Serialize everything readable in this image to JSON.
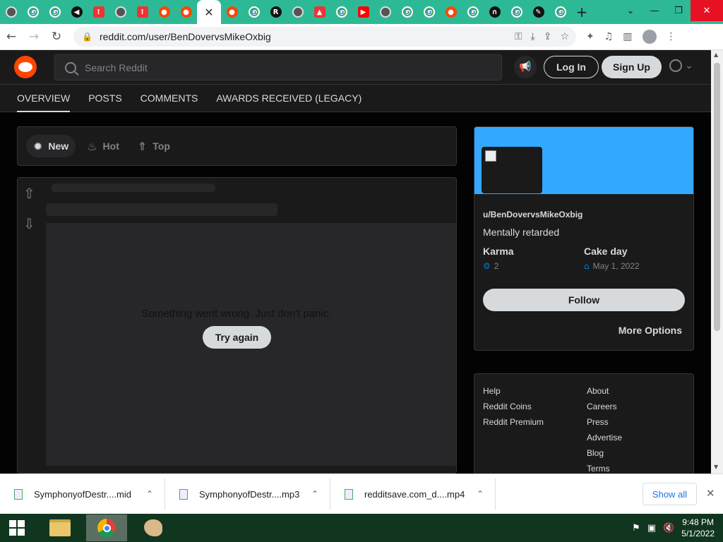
{
  "browser": {
    "tabs": [
      {
        "icon": "globe-icon",
        "cls": "w",
        "glyph": ""
      },
      {
        "icon": "google-icon",
        "cls": "g",
        "glyph": "G"
      },
      {
        "icon": "google-icon",
        "cls": "g",
        "glyph": "G"
      },
      {
        "icon": "audio-icon",
        "cls": "dk",
        "glyph": "◀"
      },
      {
        "icon": "mail-icon",
        "cls": "m",
        "glyph": "!"
      },
      {
        "icon": "chrome-icon",
        "cls": "w",
        "glyph": ""
      },
      {
        "icon": "mail-icon",
        "cls": "m",
        "glyph": "!"
      },
      {
        "icon": "reddit-icon",
        "cls": "r",
        "glyph": "●"
      },
      {
        "icon": "reddit-icon",
        "cls": "r",
        "glyph": "●"
      },
      {
        "icon": "close-icon",
        "cls": "active",
        "glyph": "✕"
      },
      {
        "icon": "reddit-icon",
        "cls": "r",
        "glyph": "●"
      },
      {
        "icon": "google-icon",
        "cls": "g",
        "glyph": "G"
      },
      {
        "icon": "r-icon",
        "cls": "dk",
        "glyph": "R"
      },
      {
        "icon": "globe-icon",
        "cls": "w",
        "glyph": ""
      },
      {
        "icon": "alert-icon",
        "cls": "m",
        "glyph": "▲"
      },
      {
        "icon": "google-icon",
        "cls": "g",
        "glyph": "G"
      },
      {
        "icon": "youtube-icon",
        "cls": "y",
        "glyph": "▶"
      },
      {
        "icon": "chrome-icon",
        "cls": "w",
        "glyph": ""
      },
      {
        "icon": "google-icon",
        "cls": "g",
        "glyph": "G"
      },
      {
        "icon": "google-icon",
        "cls": "g",
        "glyph": "G"
      },
      {
        "icon": "reddit-icon",
        "cls": "r",
        "glyph": "●"
      },
      {
        "icon": "google-icon",
        "cls": "g",
        "glyph": "G"
      },
      {
        "icon": "headphones-icon",
        "cls": "dk",
        "glyph": "∩"
      },
      {
        "icon": "google-icon",
        "cls": "g",
        "glyph": "G"
      },
      {
        "icon": "puzzle-icon",
        "cls": "dk",
        "glyph": "✎"
      },
      {
        "icon": "google-icon",
        "cls": "g",
        "glyph": "G"
      }
    ],
    "url": "reddit.com/user/BenDovervsMikeOxbig"
  },
  "header": {
    "search_placeholder": "Search Reddit",
    "login_label": "Log In",
    "signup_label": "Sign Up"
  },
  "profile_nav": [
    "OVERVIEW",
    "POSTS",
    "COMMENTS",
    "AWARDS RECEIVED (LEGACY)"
  ],
  "sort": {
    "new": "New",
    "hot": "Hot",
    "top": "Top"
  },
  "post": {
    "error_text": "Something went wrong. Just don't panic.",
    "retry_label": "Try again"
  },
  "profile_card": {
    "username": "u/BenDovervsMikeOxbig",
    "description": "Mentally retarded",
    "karma_label": "Karma",
    "karma_value": "2",
    "cake_label": "Cake day",
    "cake_value": "May 1, 2022",
    "follow_label": "Follow",
    "more_label": "More Options",
    "banner_color": "#33a8ff"
  },
  "footer": {
    "col1": [
      "Help",
      "Reddit Coins",
      "Reddit Premium"
    ],
    "col2": [
      "About",
      "Careers",
      "Press",
      "Advertise",
      "Blog",
      "Terms"
    ]
  },
  "downloads": {
    "items": [
      {
        "name": "SymphonyofDestr....mid"
      },
      {
        "name": "SymphonyofDestr....mp3"
      },
      {
        "name": "redditsave.com_d....mp4"
      }
    ],
    "show_all": "Show all"
  },
  "taskbar": {
    "time": "9:48 PM",
    "date": "5/1/2022"
  }
}
